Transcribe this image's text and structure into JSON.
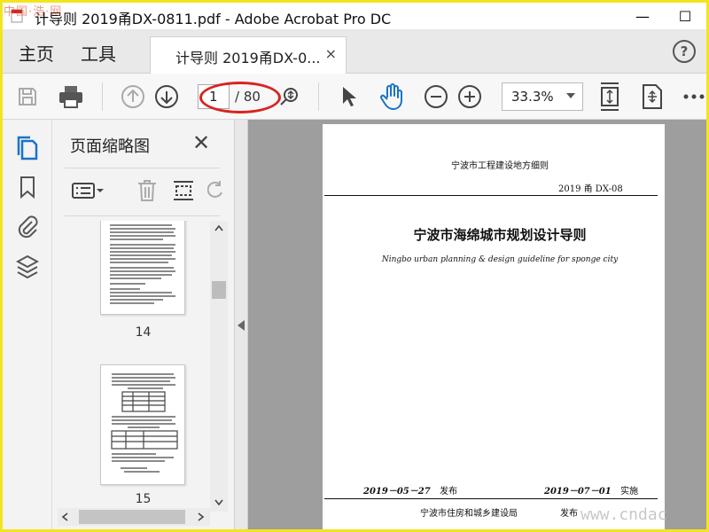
{
  "window": {
    "title": "计导则 2019甬DX-0811.pdf - Adobe Acrobat Pro DC",
    "minimize_glyph": "—",
    "maximize_glyph": "☐",
    "watermark_top": "中国·浩·网"
  },
  "tabs": {
    "home": "主页",
    "tools": "工具",
    "document": "计导则 2019甬DX-0...",
    "close_glyph": "×",
    "help_glyph": "?"
  },
  "toolbar": {
    "icons": [
      "save-icon",
      "print-icon",
      "page-up-icon",
      "page-down-icon",
      "zoom-marquee-icon",
      "select-cursor-icon",
      "hand-tool-icon",
      "zoom-out-icon",
      "zoom-in-icon",
      "fit-page-icon",
      "full-screen-icon",
      "more-icon"
    ],
    "current_page": "1",
    "page_total": "/ 80",
    "zoom": "33.3%",
    "highlight_color": "#d8231f"
  },
  "sidebar": {
    "icons": [
      "pages-icon",
      "bookmark-icon",
      "attachment-icon",
      "layers-icon"
    ],
    "active_color": "#1a73c9"
  },
  "thumbnail_panel": {
    "title": "页面缩略图",
    "close_glyph": "✕",
    "icons": [
      "options-menu-icon",
      "delete-icon",
      "extract-icon",
      "rotate-icon"
    ],
    "thumbnails": [
      {
        "page": "14"
      },
      {
        "page": "15"
      }
    ]
  },
  "document": {
    "header": "宁波市工程建设地方细则",
    "code": "2019 甬  DX-08",
    "title": "宁波市海绵城市规划设计导则",
    "subtitle": "Ningbo urban planning & design guideline for sponge city",
    "publish_date": "2019－05－27",
    "publish_label": "发布",
    "implement_date": "2019－07－01",
    "implement_label": "实施",
    "issuer": "宁波市住房和城乡建设局",
    "issue_label": "发布"
  },
  "watermark_bottom": "www.cndac"
}
